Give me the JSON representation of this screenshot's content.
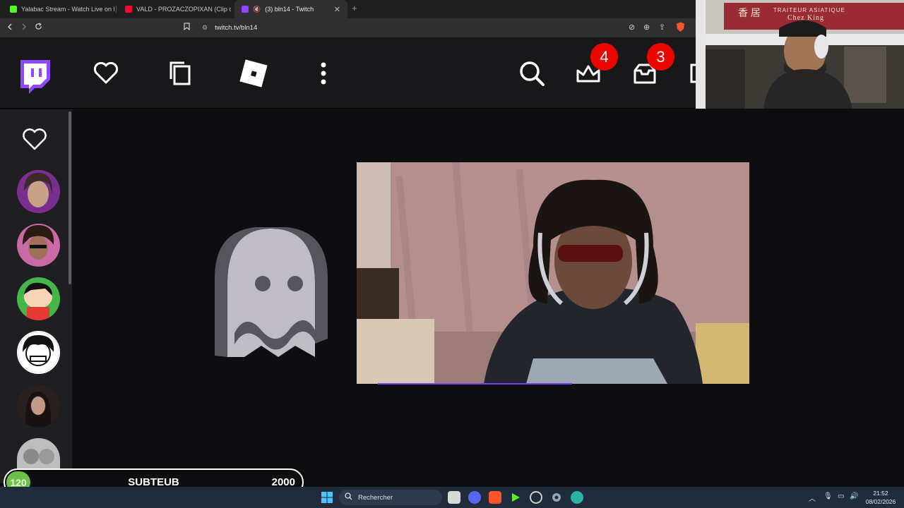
{
  "browser": {
    "tabs": [
      {
        "title": "Yalabac Stream - Watch Live on Kick",
        "favicon_color": "#53fc18"
      },
      {
        "title": "VALD - PROZACZOPIXAN (Clip officiel)",
        "favicon_color": "#ff0033"
      },
      {
        "title": "(3) bln14 - Twitch",
        "favicon_color": "#9146ff",
        "active": true,
        "close": "✕"
      }
    ],
    "new_tab": "+",
    "url": "twitch.tv/bln14"
  },
  "twitch_nav": {
    "logo": "twitch-logo-icon",
    "icons": [
      "heart-icon",
      "copy-icon",
      "roblox-icon",
      "more-vertical-icon",
      "search-icon",
      "crown-icon",
      "inbox-icon"
    ],
    "crown_badge": "4",
    "inbox_badge": "3",
    "brand_color": "#9146ff"
  },
  "cam_overlay": {
    "sign_chinese": "香 居",
    "sign_text": "TRAITEUR ASIATIQUE",
    "sign_text2": "Chez King"
  },
  "sidebar": {
    "heart_icon": "heart-icon",
    "channels": [
      "channel-1",
      "channel-2",
      "channel-3",
      "channel-4",
      "channel-5",
      "channel-6"
    ]
  },
  "main": {
    "ghost_icon": "ghost-icon"
  },
  "subgoal": {
    "current": "120",
    "label": "SUBTEUB",
    "target": "2000",
    "accent": "#6cc04a"
  },
  "taskbar": {
    "search_placeholder": "Rechercher",
    "time": "21:52",
    "date": "08/02/2026"
  }
}
